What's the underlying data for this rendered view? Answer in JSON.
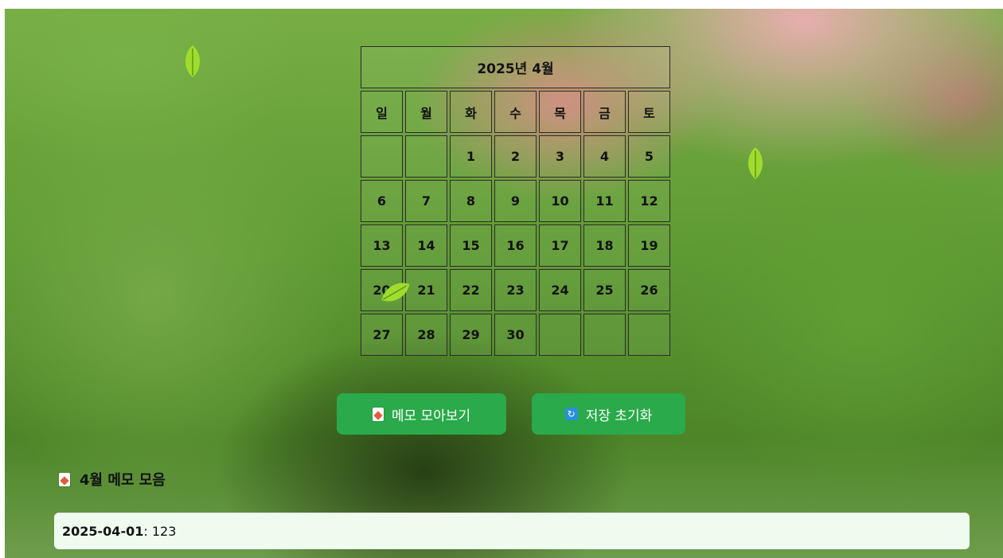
{
  "calendar": {
    "title": "2025년 4월",
    "weekdays": [
      "일",
      "월",
      "화",
      "수",
      "목",
      "금",
      "토"
    ],
    "weeks": [
      [
        "",
        "",
        "1",
        "2",
        "3",
        "4",
        "5"
      ],
      [
        "6",
        "7",
        "8",
        "9",
        "10",
        "11",
        "12"
      ],
      [
        "13",
        "14",
        "15",
        "16",
        "17",
        "18",
        "19"
      ],
      [
        "20",
        "21",
        "22",
        "23",
        "24",
        "25",
        "26"
      ],
      [
        "27",
        "28",
        "29",
        "30",
        "",
        "",
        ""
      ]
    ]
  },
  "buttons": {
    "memo_view": {
      "icon": "memo-icon",
      "label": "메모 모아보기"
    },
    "reset_storage": {
      "icon": "refresh-icon",
      "label": "저장 초기화"
    }
  },
  "memo_section": {
    "icon": "memo-icon",
    "title": "4월 메모 모음",
    "entries": [
      {
        "date": "2025-04-01",
        "separator": ": ",
        "text": "123"
      }
    ]
  },
  "colors": {
    "button": "#2aaa4a",
    "memo_background": "#eefbee",
    "leaf": "#9fdc2e"
  }
}
